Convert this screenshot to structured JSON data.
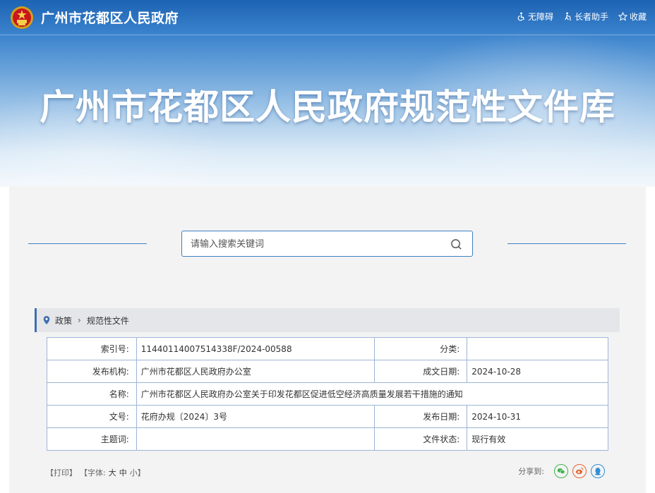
{
  "header": {
    "site_title": "广州市花都区人民政府",
    "tools": [
      {
        "label": "无障碍",
        "icon": "accessibility-icon"
      },
      {
        "label": "长者助手",
        "icon": "elder-helper-icon"
      },
      {
        "label": "收藏",
        "icon": "star-icon"
      }
    ]
  },
  "hero": {
    "title": "广州市花都区人民政府规范性文件库"
  },
  "search": {
    "placeholder": "请输入搜索关键词",
    "value": ""
  },
  "breadcrumb": {
    "items": [
      "政策",
      "规范性文件"
    ]
  },
  "doc_info": {
    "index_label": "索引号:",
    "index_value": "11440114007514338F/2024-00588",
    "category_label": "分类:",
    "category_value": "",
    "issuer_label": "发布机构:",
    "issuer_value": "广州市花都区人民政府办公室",
    "created_label": "成文日期:",
    "created_value": "2024-10-28",
    "name_label": "名称:",
    "name_value": "广州市花都区人民政府办公室关于印发花都区促进低空经济高质量发展若干措施的通知",
    "docno_label": "文号:",
    "docno_value": "花府办规〔2024〕3号",
    "published_label": "发布日期:",
    "published_value": "2024-10-31",
    "subject_label": "主题词:",
    "subject_value": "",
    "status_label": "文件状态:",
    "status_value": "现行有效"
  },
  "footer": {
    "print_label": "【打印】",
    "font_label": "【字体:",
    "font_large": "大",
    "font_medium": "中",
    "font_small": "小】",
    "share_label": "分享到:"
  },
  "colors": {
    "accent": "#3f7fc4",
    "wechat": "#3fb34f",
    "weibo": "#e8622c",
    "qq": "#2f8fd8"
  }
}
